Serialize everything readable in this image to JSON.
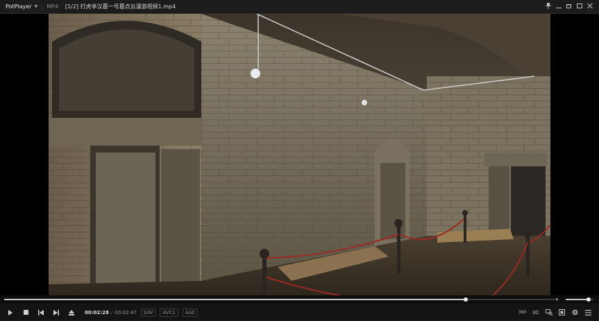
{
  "titlebar": {
    "app_name": "PotPlayer",
    "format": "MP4",
    "title": "[1/2] 打虎亭汉墓一号墓点云漫游视频1.mp4"
  },
  "window_buttons": [
    "pin-icon",
    "minimize-icon",
    "restore-icon",
    "maximize-icon",
    "close-icon"
  ],
  "playback": {
    "current_time": "00:02:28",
    "total_time": "00:02:47",
    "progress": 0.836,
    "volume": 0.82
  },
  "badges": [
    "S/W",
    "AVC1",
    "AAC"
  ],
  "right_controls": [
    "360",
    "3D"
  ],
  "colors": {
    "title_bg": "#1c1c1c",
    "controls_bg": "#141414",
    "accent": "#c9c9c9"
  }
}
